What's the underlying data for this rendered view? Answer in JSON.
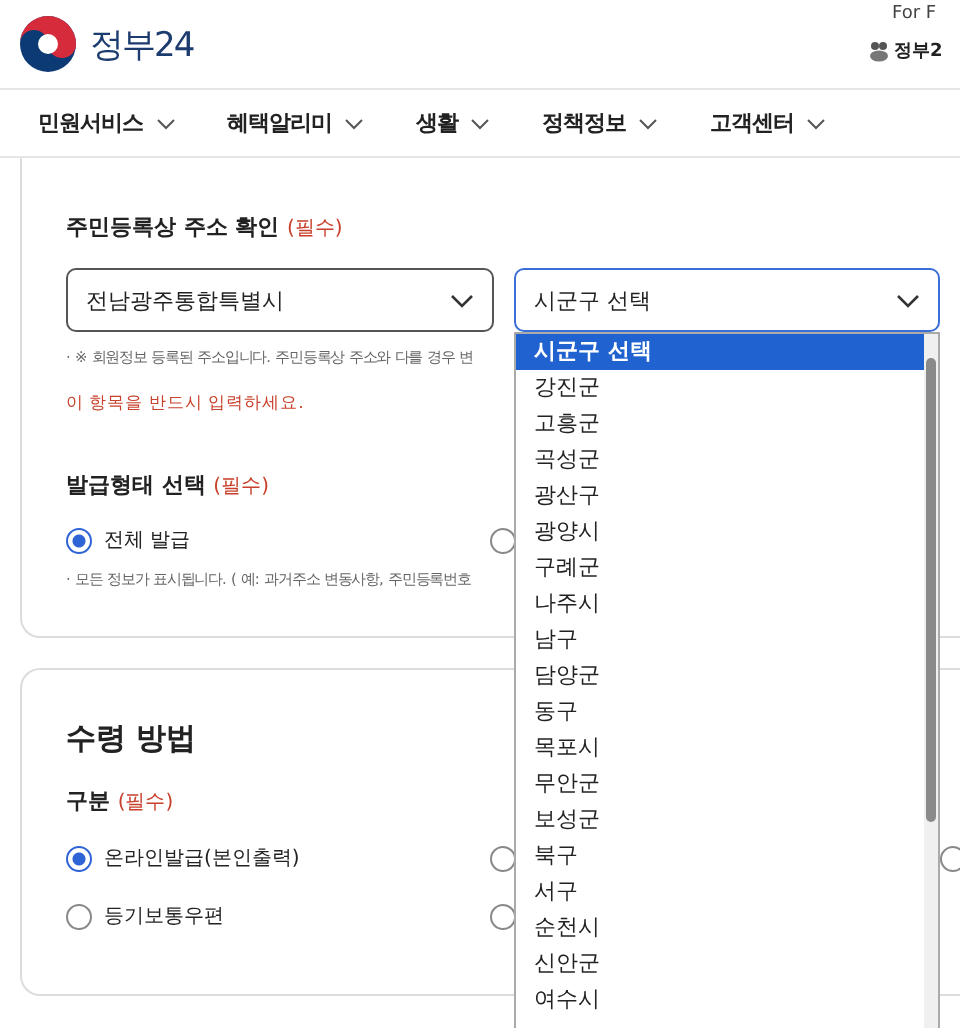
{
  "header": {
    "logo": "정부24",
    "links": [
      {
        "label": "For F"
      },
      {
        "label": "정부2"
      }
    ]
  },
  "nav": [
    {
      "label": "민원서비스"
    },
    {
      "label": "혜택알리미"
    },
    {
      "label": "생활"
    },
    {
      "label": "정책정보"
    },
    {
      "label": "고객센터"
    }
  ],
  "address_section": {
    "title": "주민등록상 주소 확인",
    "required": "(필수)",
    "province_select": {
      "value": "전남광주통합특별시"
    },
    "district_select": {
      "value": "시군구 선택",
      "expanded": true,
      "options": [
        {
          "label": "시군구 선택",
          "selected": true
        },
        {
          "label": "강진군",
          "selected": false
        },
        {
          "label": "고흥군",
          "selected": false
        },
        {
          "label": "곡성군",
          "selected": false
        },
        {
          "label": "광산구",
          "selected": false
        },
        {
          "label": "광양시",
          "selected": false
        },
        {
          "label": "구례군",
          "selected": false
        },
        {
          "label": "나주시",
          "selected": false
        },
        {
          "label": "남구",
          "selected": false
        },
        {
          "label": "담양군",
          "selected": false
        },
        {
          "label": "동구",
          "selected": false
        },
        {
          "label": "목포시",
          "selected": false
        },
        {
          "label": "무안군",
          "selected": false
        },
        {
          "label": "보성군",
          "selected": false
        },
        {
          "label": "북구",
          "selected": false
        },
        {
          "label": "서구",
          "selected": false
        },
        {
          "label": "순천시",
          "selected": false
        },
        {
          "label": "신안군",
          "selected": false
        },
        {
          "label": "여수시",
          "selected": false
        }
      ]
    },
    "note": "· ※ 회원정보 등록된 주소입니다. 주민등록상 주소와 다를 경우 변",
    "error": "이 항목을 반드시 입력하세요."
  },
  "issue_type": {
    "title": "발급형태 선택",
    "required": "(필수)",
    "options": [
      {
        "kind": "labeled",
        "label": "전체 발급",
        "selected": true
      },
      {
        "kind": "covered",
        "selected": false
      }
    ],
    "note": "· 모든 정보가 표시됩니다. ( 예: 과거주소 변동사항, 주민등록번호"
  },
  "receipt": {
    "title": "수령 방법",
    "field_label": "구분",
    "required": "(필수)",
    "rows": [
      [
        {
          "kind": "labeled",
          "label": "온라인발급(본인출력)",
          "selected": true
        },
        {
          "kind": "covered",
          "selected": false
        },
        {
          "kind": "covered",
          "selected": false
        }
      ],
      [
        {
          "kind": "labeled",
          "label": "등기보통우편",
          "selected": false
        },
        {
          "kind": "covered",
          "selected": false
        }
      ]
    ]
  }
}
